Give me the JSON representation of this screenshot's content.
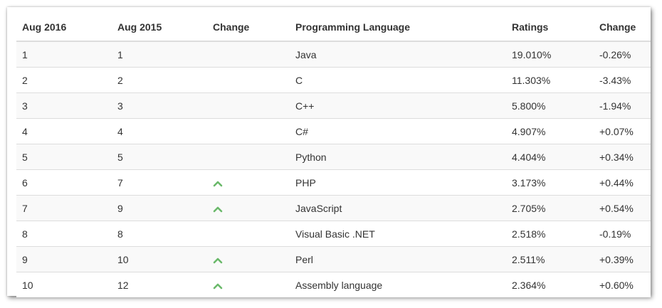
{
  "table": {
    "headers": [
      "Aug 2016",
      "Aug 2015",
      "Change",
      "Programming Language",
      "Ratings",
      "Change"
    ],
    "rows": [
      {
        "rank_2016": "1",
        "rank_2015": "1",
        "trend": "",
        "language": "Java",
        "rating": "19.010%",
        "change": "-0.26%"
      },
      {
        "rank_2016": "2",
        "rank_2015": "2",
        "trend": "",
        "language": "C",
        "rating": "11.303%",
        "change": "-3.43%"
      },
      {
        "rank_2016": "3",
        "rank_2015": "3",
        "trend": "",
        "language": "C++",
        "rating": "5.800%",
        "change": "-1.94%"
      },
      {
        "rank_2016": "4",
        "rank_2015": "4",
        "trend": "",
        "language": "C#",
        "rating": "4.907%",
        "change": "+0.07%"
      },
      {
        "rank_2016": "5",
        "rank_2015": "5",
        "trend": "",
        "language": "Python",
        "rating": "4.404%",
        "change": "+0.34%"
      },
      {
        "rank_2016": "6",
        "rank_2015": "7",
        "trend": "up-chevron-icon",
        "language": "PHP",
        "rating": "3.173%",
        "change": "+0.44%"
      },
      {
        "rank_2016": "7",
        "rank_2015": "9",
        "trend": "up-chevron-icon",
        "language": "JavaScript",
        "rating": "2.705%",
        "change": "+0.54%"
      },
      {
        "rank_2016": "8",
        "rank_2015": "8",
        "trend": "",
        "language": "Visual Basic .NET",
        "rating": "2.518%",
        "change": "-0.19%"
      },
      {
        "rank_2016": "9",
        "rank_2015": "10",
        "trend": "up-chevron-icon",
        "language": "Perl",
        "rating": "2.511%",
        "change": "+0.39%"
      },
      {
        "rank_2016": "10",
        "rank_2015": "12",
        "trend": "up-chevron-icon",
        "language": "Assembly language",
        "rating": "2.364%",
        "change": "+0.60%"
      }
    ]
  },
  "colors": {
    "trend_up": "#6ab96a",
    "row_stripe": "#f9f9f9",
    "border": "#dddddd",
    "text": "#333333"
  }
}
